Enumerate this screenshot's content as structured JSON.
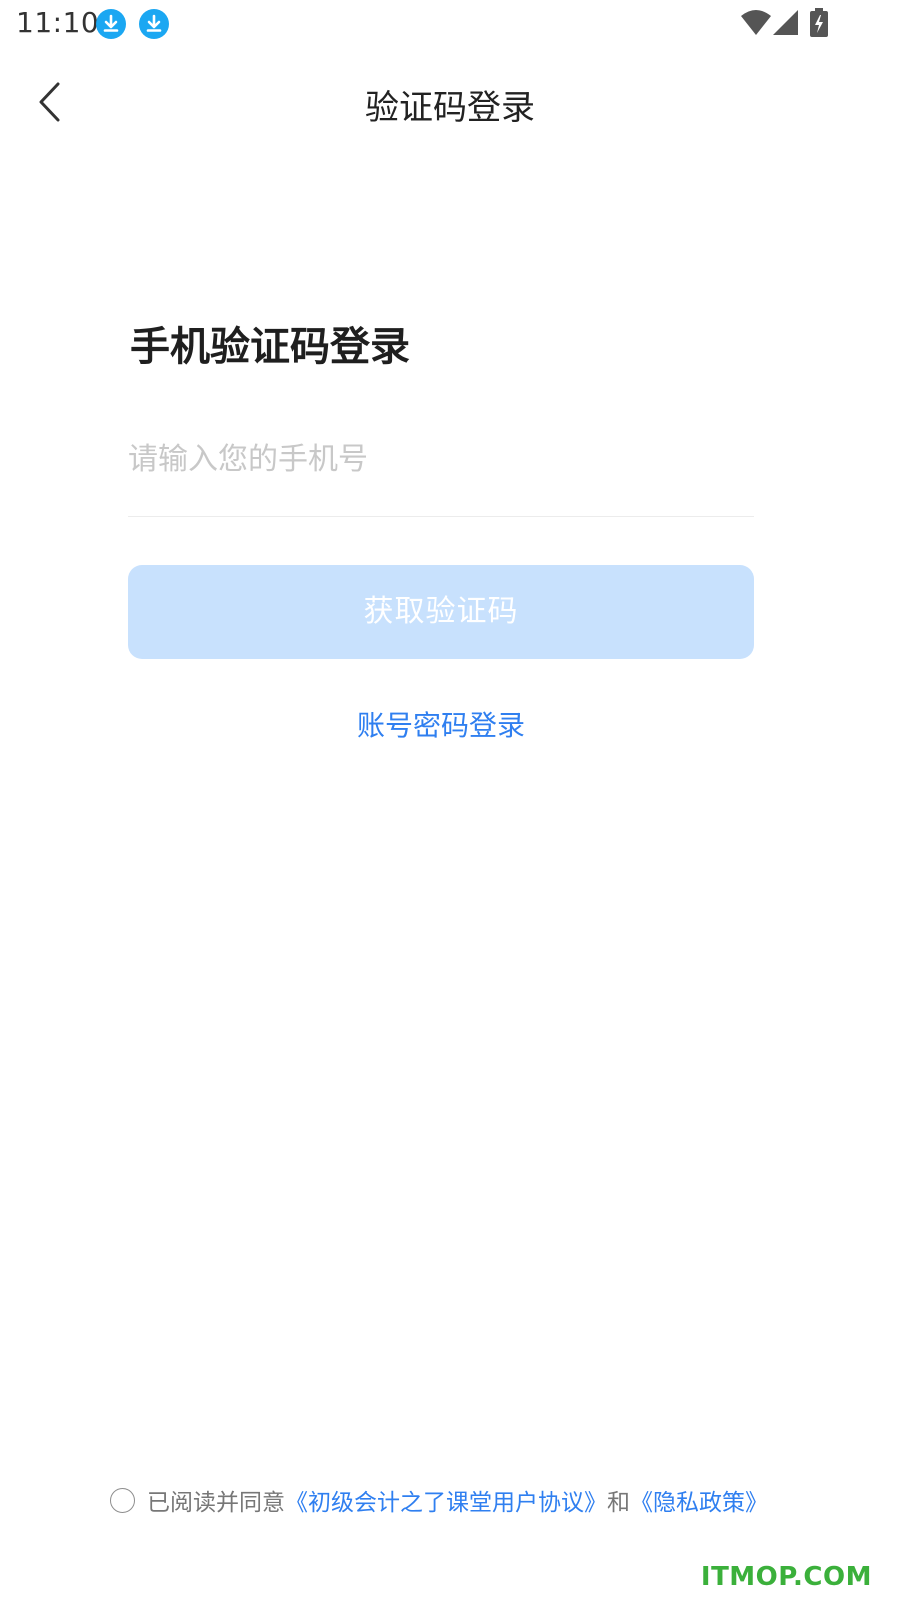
{
  "status_bar": {
    "time": "11:10",
    "icons": [
      "download-icon",
      "download-icon",
      "wifi-icon",
      "signal-icon",
      "battery-charging-icon"
    ]
  },
  "header": {
    "back_icon": "chevron-left-icon",
    "title": "验证码登录"
  },
  "main": {
    "heading": "手机验证码登录",
    "phone_input": {
      "value": "",
      "placeholder": "请输入您的手机号"
    },
    "get_code_button": "获取验证码",
    "password_login_link": "账号密码登录"
  },
  "agreement": {
    "checked": false,
    "prefix": "已阅读并同意",
    "user_agreement": "《初级会计之了课堂用户协议》",
    "conjunction": "和",
    "privacy_policy": "《隐私政策》"
  },
  "watermark": "ITMOP.COM",
  "colors": {
    "accent": "#2f7ff0",
    "button_disabled": "#c8e1fd",
    "download_badge": "#1ba7f2",
    "watermark": "#3bb03b"
  }
}
